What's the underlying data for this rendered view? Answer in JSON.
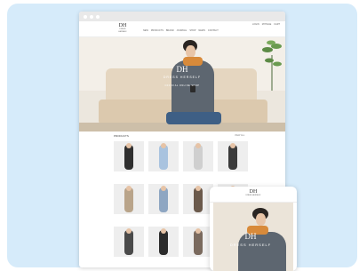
{
  "browser": {
    "title": ""
  },
  "site": {
    "logo_mark": "DH",
    "logo_word": "DRESS HERSELF",
    "nav": [
      "NEW",
      "PRODUCTS",
      "BRAND",
      "JOURNAL",
      "SHOP",
      "NEWS",
      "CONTACT"
    ],
    "account": [
      "LOGIN",
      "MYPAGE",
      "CART"
    ]
  },
  "hero": {
    "mark": "DH",
    "name": "DRESS HERSELF",
    "sub": "OFFICIAL ONLINE SHOP"
  },
  "products": {
    "title": "PRODUCTS",
    "view_all": "VIEW ALL",
    "items": [
      {
        "caption": "",
        "price": "",
        "color": "#2f2f2f"
      },
      {
        "caption": "",
        "price": "",
        "color": "#a9c3df"
      },
      {
        "caption": "",
        "price": "",
        "color": "#cfcfcf"
      },
      {
        "caption": "",
        "price": "",
        "color": "#3b3b3b"
      },
      {
        "caption": "",
        "price": "",
        "color": "#b9a48a"
      },
      {
        "caption": "",
        "price": "",
        "color": "#8ea6c2"
      },
      {
        "caption": "",
        "price": "",
        "color": "#6b5a4c"
      },
      {
        "caption": "",
        "price": "",
        "color": "#d9d3ca"
      },
      {
        "caption": "",
        "price": "",
        "color": "#4a4a4a"
      },
      {
        "caption": "",
        "price": "",
        "color": "#2b2b2b"
      },
      {
        "caption": "",
        "price": "",
        "color": "#7a6a5e"
      },
      {
        "caption": "",
        "price": "",
        "color": "#e0d8cc"
      }
    ]
  },
  "mobile": {
    "logo_mark": "DH",
    "logo_word": "DRESS HERSELF",
    "hero_mark": "DH",
    "hero_name": "DRESS HERSELF"
  },
  "colors": {
    "background": "#d6ebfa",
    "accent_scarf": "#d88a3a",
    "sweater": "#5d6670"
  }
}
